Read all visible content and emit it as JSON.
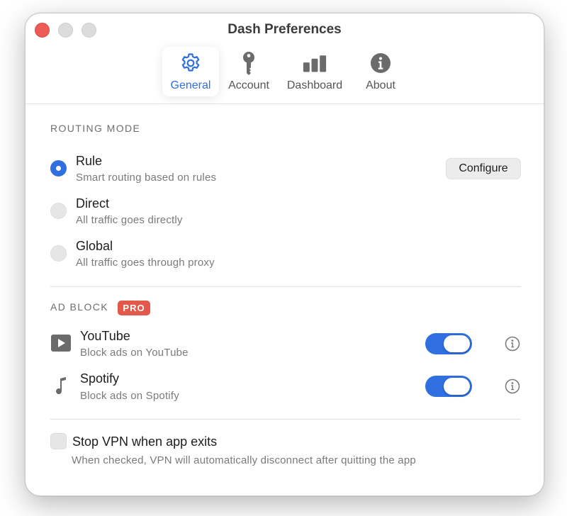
{
  "window": {
    "title": "Dash Preferences"
  },
  "tabs": [
    {
      "label": "General",
      "icon": "gear-icon",
      "active": true
    },
    {
      "label": "Account",
      "icon": "key-icon",
      "active": false
    },
    {
      "label": "Dashboard",
      "icon": "bar-chart-icon",
      "active": false
    },
    {
      "label": "About",
      "icon": "info-circle-icon",
      "active": false
    }
  ],
  "routing": {
    "section_title": "ROUTING MODE",
    "options": [
      {
        "title": "Rule",
        "description": "Smart routing based on rules",
        "selected": true
      },
      {
        "title": "Direct",
        "description": "All traffic goes directly",
        "selected": false
      },
      {
        "title": "Global",
        "description": "All traffic goes through proxy",
        "selected": false
      }
    ],
    "configure_label": "Configure"
  },
  "adblock": {
    "section_title": "AD BLOCK",
    "badge": "PRO",
    "items": [
      {
        "title": "YouTube",
        "description": "Block ads on YouTube",
        "icon": "play-icon",
        "enabled": true
      },
      {
        "title": "Spotify",
        "description": "Block ads on Spotify",
        "icon": "music-note-icon",
        "enabled": true
      }
    ]
  },
  "stop_vpn": {
    "label": "Stop VPN when app exits",
    "description": "When checked, VPN will automatically disconnect after quitting the app",
    "checked": false
  },
  "colors": {
    "accent": "#2f6fe0",
    "badge": "#e2584b",
    "close": "#ee5b55"
  }
}
